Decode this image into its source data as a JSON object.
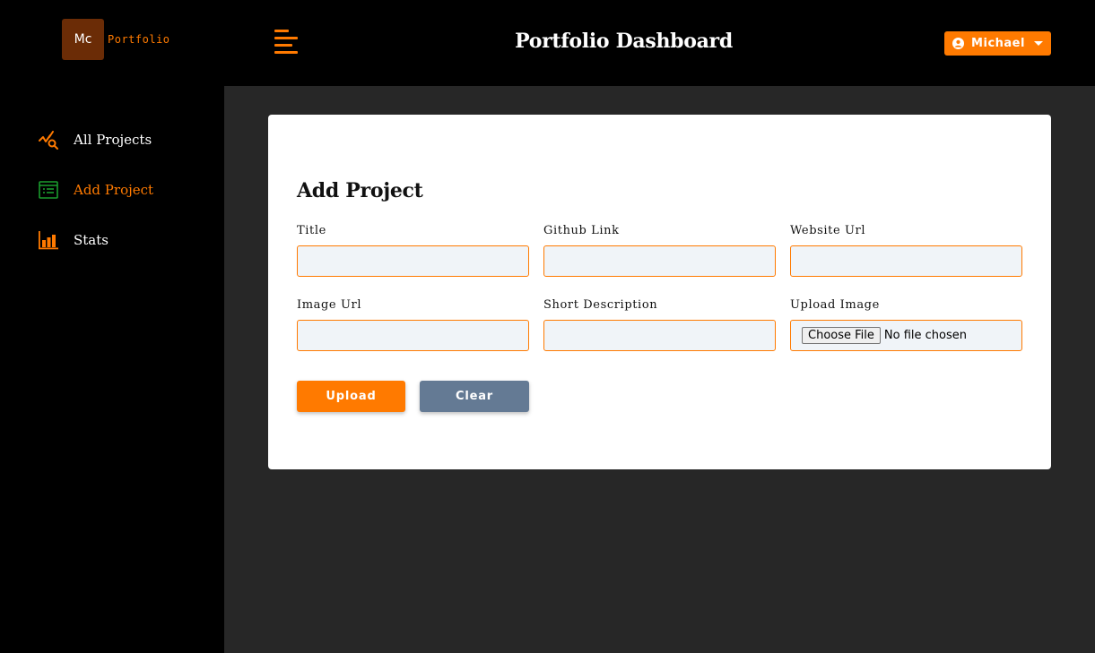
{
  "logo": {
    "initials": "Mc",
    "text": "Portfolio"
  },
  "sidebar": {
    "items": [
      {
        "label": "All Projects",
        "icon": "chart-search-icon",
        "active": false
      },
      {
        "label": "Add Project",
        "icon": "form-icon",
        "active": true
      },
      {
        "label": "Stats",
        "icon": "bar-chart-icon",
        "active": false
      }
    ]
  },
  "header": {
    "title": "Portfolio Dashboard",
    "user": {
      "name": "Michael",
      "icon": "user-circle-icon"
    }
  },
  "form": {
    "title": "Add Project",
    "fields": [
      {
        "label": "Title",
        "value": ""
      },
      {
        "label": "Github Link",
        "value": ""
      },
      {
        "label": "Website Url",
        "value": ""
      },
      {
        "label": "Image Url",
        "value": ""
      },
      {
        "label": "Short Description",
        "value": ""
      },
      {
        "label": "Upload Image",
        "button": "Choose File",
        "status": "No file chosen"
      }
    ],
    "upload_label": "Upload",
    "clear_label": "Clear"
  },
  "colors": {
    "accent": "#ff7a00",
    "clear_button": "#647a94",
    "main_bg": "#272727",
    "input_bg": "#f0f4f8",
    "logo_bg": "#6b2c06"
  }
}
